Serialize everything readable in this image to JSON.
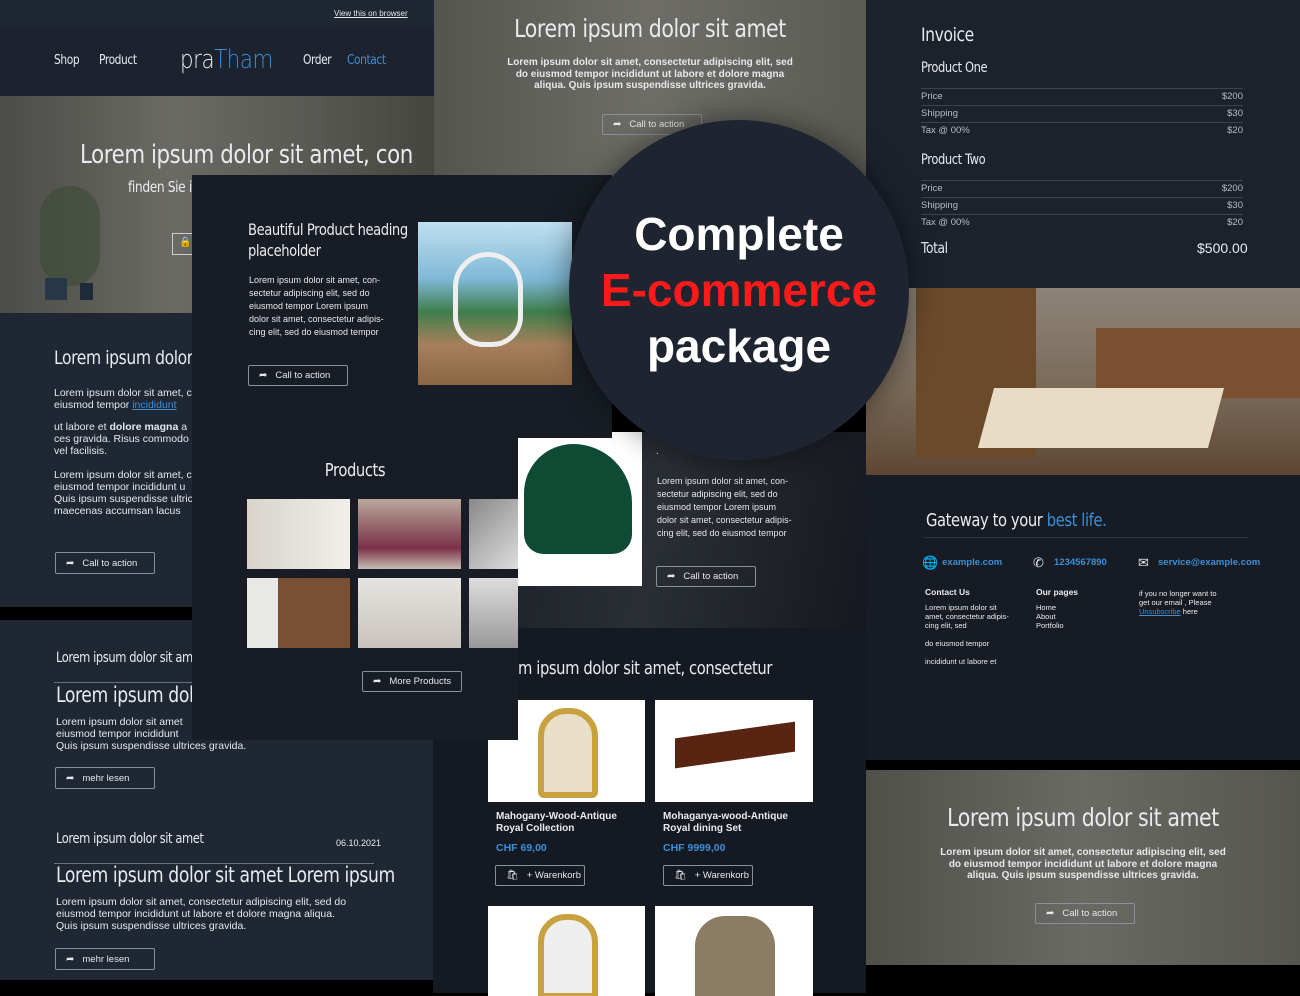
{
  "left": {
    "view_browser": "View this on browser",
    "nav": {
      "shop": "Shop",
      "product": "Product",
      "logo_a": "pra",
      "logo_b": "Tham",
      "order": "Order",
      "contact": "Contact"
    },
    "hero": {
      "title": "Lorem ipsum dolor sit amet, con",
      "subtitle": "finden Sie in"
    },
    "section": {
      "title": "Lorem ipsum dolor s",
      "p1a": "Lorem ipsum dolor sit amet, c",
      "p1b": "eiusmod tempor ",
      "p1link": "incididunt",
      "p2a": "ut labore et ",
      "p2b": "dolore magna",
      "p2c": " a",
      "p2d": "ces gravida. Risus commodo",
      "p2e": "vel facilisis.",
      "p3": [
        "Lorem ipsum dolor sit amet, c",
        "eiusmod tempor incididunt u",
        "Quis ipsum suspendisse ultric",
        "maecenas accumsan lacus"
      ],
      "cta": "Call to action"
    },
    "blog1": {
      "kicker": "Lorem ipsum dolor sit amet",
      "title": "Lorem ipsum dolor",
      "lines": [
        "Lorem ipsum dolor sit amet",
        "eiusmod tempor incididunt",
        "Quis ipsum suspendisse ultrices gravida."
      ],
      "button": "mehr lesen"
    },
    "blog2": {
      "kicker": "Lorem ipsum dolor sit amet",
      "date": "06.10.2021",
      "title": "Lorem ipsum dolor sit amet Lorem ipsum",
      "lines": [
        "Lorem ipsum dolor sit amet, consectetur adipiscing elit, sed do",
        "eiusmod tempor incididunt ut labore et dolore magna aliqua.",
        "Quis ipsum suspendisse ultrices gravida."
      ],
      "button": "mehr lesen"
    }
  },
  "top_hero": {
    "title": "Lorem ipsum dolor sit amet",
    "lines": [
      "Lorem ipsum dolor sit amet, consectetur adipiscing elit, sed",
      "do eiusmod tempor incididunt ut labore et dolore magna",
      "aliqua. Quis ipsum suspendisse ultrices gravida."
    ],
    "cta": "Call to action"
  },
  "feature": {
    "heading": [
      "Beautiful Product heading",
      "placeholder"
    ],
    "lines": [
      "Lorem ipsum dolor sit amet, con-",
      "sectetur adipiscing elit, sed do",
      "eiusmod tempor Lorem ipsum",
      "dolor sit amet, consectetur adipis-",
      "cing elit, sed do eiusmod tempor"
    ],
    "cta": "Call to action"
  },
  "products": {
    "title": "Products",
    "button": "More Products"
  },
  "green": {
    "dot": ".",
    "lines": [
      "Lorem ipsum dolor sit amet, con-",
      "sectetur adipiscing elit, sed do",
      "eiusmod tempor Lorem ipsum",
      "dolor sit amet, consectetur adipis-",
      "cing elit, sed do eiusmod tempor"
    ],
    "cta": "Call to action"
  },
  "shop": {
    "title": "m ipsum dolor sit amet, consectetur",
    "items": [
      {
        "name1": "Mahogany-Wood-Antique",
        "name2": "Royal Collection",
        "price": "CHF 69,00",
        "button": "+ Warenkorb"
      },
      {
        "name1": "Mohaganya-wood-Antique",
        "name2": "Royal dining Set",
        "price": "CHF 9999,00",
        "button": "+ Warenkorb"
      }
    ]
  },
  "badge": {
    "line1": "Complete",
    "line2": "E-commerce",
    "line3": "package",
    "accent": "#ff1a1a"
  },
  "invoice": {
    "title": "Invoice",
    "groups": [
      {
        "name": "Product One",
        "rows": [
          [
            "Price",
            "$200"
          ],
          [
            "Shipping",
            "$30"
          ],
          [
            "Tax @ 00%",
            "$20"
          ]
        ]
      },
      {
        "name": "Product Two",
        "rows": [
          [
            "Price",
            "$200"
          ],
          [
            "Shipping",
            "$30"
          ],
          [
            "Tax @ 00%",
            "$20"
          ]
        ]
      }
    ],
    "total_label": "Total",
    "total": "$500.00"
  },
  "footer": {
    "tag_a": "Gateway to your ",
    "tag_b": "best life.",
    "web": "example.com",
    "phone": "1234567890",
    "email": "service@example.com",
    "contact_title": "Contact Us",
    "contact_lines": [
      "Lorem ipsum dolor sit",
      "amet, consectetur adipis-",
      "cing elit, sed"
    ],
    "contact_l2": "do eiusmod tempor",
    "contact_l3": "incididunt ut labore et",
    "pages_title": "Our pages",
    "pages": [
      "Home",
      "About",
      "Portfolio"
    ],
    "unsub_1": "if you no longer want to",
    "unsub_2": "get our email , Please",
    "unsub_link": "Unsubscribe",
    "unsub_3": " here"
  },
  "bottom_hero": {
    "title": "Lorem ipsum dolor sit amet",
    "lines": [
      "Lorem ipsum dolor sit amet, consectetur adipiscing elit, sed",
      "do eiusmod tempor incididunt ut labore et dolore magna",
      "aliqua. Quis ipsum suspendisse ultrices gravida."
    ],
    "cta": "Call to action"
  },
  "colors": {
    "accent_blue": "#3a8fd8",
    "panel": "#1f2733",
    "dark": "#161b23"
  }
}
